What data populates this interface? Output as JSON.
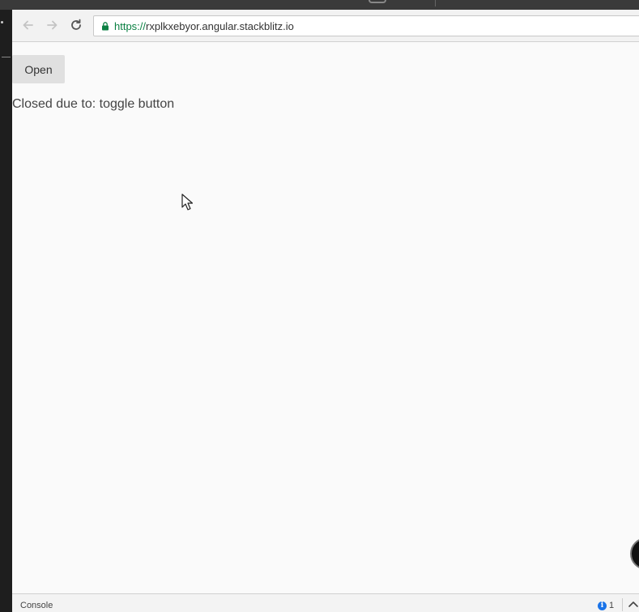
{
  "browser": {
    "url_scheme": "https://",
    "url_host": "rxplkxebyor.angular.stackblitz.io"
  },
  "page": {
    "open_button_label": "Open",
    "status_text": "Closed due to: toggle button"
  },
  "console": {
    "label": "Console",
    "info_count": "1"
  },
  "icons": {
    "back": "arrow-left-icon",
    "forward": "arrow-right-icon",
    "reload": "reload-icon",
    "lock": "lock-icon",
    "info": "info-icon",
    "expand": "chevron-up-icon",
    "cursor": "mouse-pointer-icon"
  },
  "colors": {
    "secure_green": "#0b8043",
    "page_background": "#fafafa",
    "button_background": "#e0e0e0",
    "info_blue": "#1a73e8"
  }
}
